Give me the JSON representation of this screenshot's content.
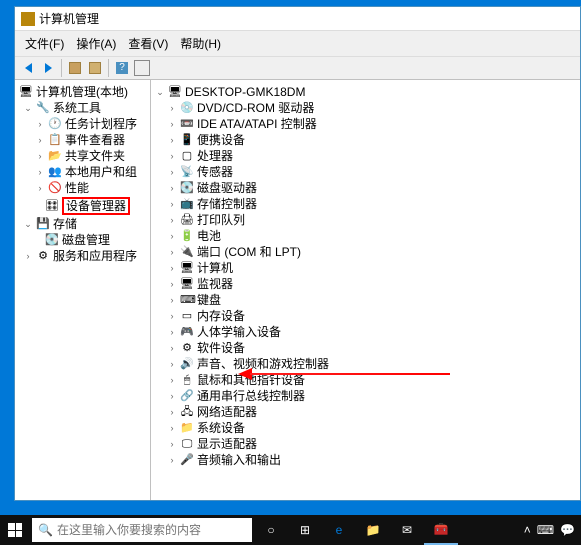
{
  "window": {
    "title": "计算机管理"
  },
  "menu": {
    "file": "文件(F)",
    "action": "操作(A)",
    "view": "查看(V)",
    "help": "帮助(H)"
  },
  "leftTree": {
    "root": "计算机管理(本地)",
    "systemTools": "系统工具",
    "taskScheduler": "任务计划程序",
    "eventViewer": "事件查看器",
    "sharedFolders": "共享文件夹",
    "localUsers": "本地用户和组",
    "performance": "性能",
    "deviceManager": "设备管理器",
    "storage": "存储",
    "diskMgmt": "磁盘管理",
    "services": "服务和应用程序"
  },
  "rightTree": {
    "computer": "DESKTOP-GMK18DM",
    "items": [
      "DVD/CD-ROM 驱动器",
      "IDE ATA/ATAPI 控制器",
      "便携设备",
      "处理器",
      "传感器",
      "磁盘驱动器",
      "存储控制器",
      "打印队列",
      "电池",
      "端口 (COM 和 LPT)",
      "计算机",
      "监视器",
      "键盘",
      "内存设备",
      "人体学输入设备",
      "软件设备",
      "声音、视频和游戏控制器",
      "鼠标和其他指针设备",
      "通用串行总线控制器",
      "网络适配器",
      "系统设备",
      "显示适配器",
      "音频输入和输出"
    ]
  },
  "iconMap": {
    "0": "💿",
    "1": "📼",
    "2": "📱",
    "3": "▢",
    "4": "📡",
    "5": "💽",
    "6": "📺",
    "7": "🖨",
    "8": "🔋",
    "9": "🔌",
    "10": "🖥",
    "11": "🖥",
    "12": "⌨",
    "13": "▭",
    "14": "🎮",
    "15": "⚙",
    "16": "🔊",
    "17": "🖱",
    "18": "🔗",
    "19": "🖧",
    "20": "📁",
    "21": "🖵",
    "22": "🎤"
  },
  "taskbar": {
    "searchPlaceholder": "在这里输入你要搜索的内容"
  }
}
